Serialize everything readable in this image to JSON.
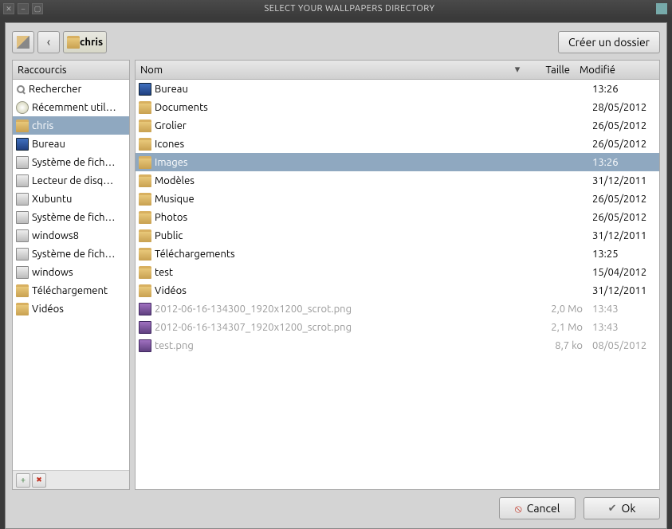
{
  "window": {
    "title": "SELECT YOUR WALLPAPERS DIRECTORY"
  },
  "toolbar": {
    "path_button": "chris",
    "create_folder": "Créer un dossier"
  },
  "sidebar": {
    "header": "Raccourcis",
    "items": [
      {
        "icon": "search",
        "label": "Rechercher"
      },
      {
        "icon": "recent",
        "label": "Récemment util…"
      },
      {
        "icon": "folder",
        "label": "chris",
        "selected": true
      },
      {
        "icon": "desktop",
        "label": "Bureau"
      },
      {
        "icon": "drive",
        "label": "Système de fich…"
      },
      {
        "icon": "drive",
        "label": "Lecteur de disq…"
      },
      {
        "icon": "drive",
        "label": "Xubuntu"
      },
      {
        "icon": "drive",
        "label": "Système de fich…"
      },
      {
        "icon": "drive",
        "label": "windows8"
      },
      {
        "icon": "drive",
        "label": "Système de fich…"
      },
      {
        "icon": "drive",
        "label": "windows"
      },
      {
        "icon": "folder",
        "label": "Téléchargement"
      },
      {
        "icon": "folder",
        "label": "Vidéos"
      }
    ],
    "add_btn": "+",
    "remove_btn": "✖"
  },
  "files": {
    "columns": {
      "name": "Nom",
      "size": "Taille",
      "modified": "Modifié"
    },
    "rows": [
      {
        "icon": "desktop",
        "name": "Bureau",
        "size": "",
        "modified": "13:26"
      },
      {
        "icon": "folder",
        "name": "Documents",
        "size": "",
        "modified": "28/05/2012"
      },
      {
        "icon": "folder",
        "name": "Grolier",
        "size": "",
        "modified": "26/05/2012"
      },
      {
        "icon": "folder",
        "name": "Icones",
        "size": "",
        "modified": "26/05/2012"
      },
      {
        "icon": "folder",
        "name": "Images",
        "size": "",
        "modified": "13:26",
        "selected": true
      },
      {
        "icon": "folder",
        "name": "Modèles",
        "size": "",
        "modified": "31/12/2011"
      },
      {
        "icon": "folder",
        "name": "Musique",
        "size": "",
        "modified": "26/05/2012"
      },
      {
        "icon": "folder",
        "name": "Photos",
        "size": "",
        "modified": "26/05/2012"
      },
      {
        "icon": "folder",
        "name": "Public",
        "size": "",
        "modified": "31/12/2011"
      },
      {
        "icon": "folder",
        "name": "Téléchargements",
        "size": "",
        "modified": "13:25"
      },
      {
        "icon": "folder",
        "name": "test",
        "size": "",
        "modified": "15/04/2012"
      },
      {
        "icon": "folder",
        "name": "Vidéos",
        "size": "",
        "modified": "31/12/2011"
      },
      {
        "icon": "image",
        "name": "2012-06-16-134300_1920x1200_scrot.png",
        "size": "2,0 Mo",
        "modified": "13:43",
        "dimmed": true
      },
      {
        "icon": "image",
        "name": "2012-06-16-134307_1920x1200_scrot.png",
        "size": "2,1 Mo",
        "modified": "13:43",
        "dimmed": true
      },
      {
        "icon": "image",
        "name": "test.png",
        "size": "8,7 ko",
        "modified": "08/05/2012",
        "dimmed": true
      }
    ]
  },
  "buttons": {
    "cancel": "Cancel",
    "ok": "Ok"
  }
}
